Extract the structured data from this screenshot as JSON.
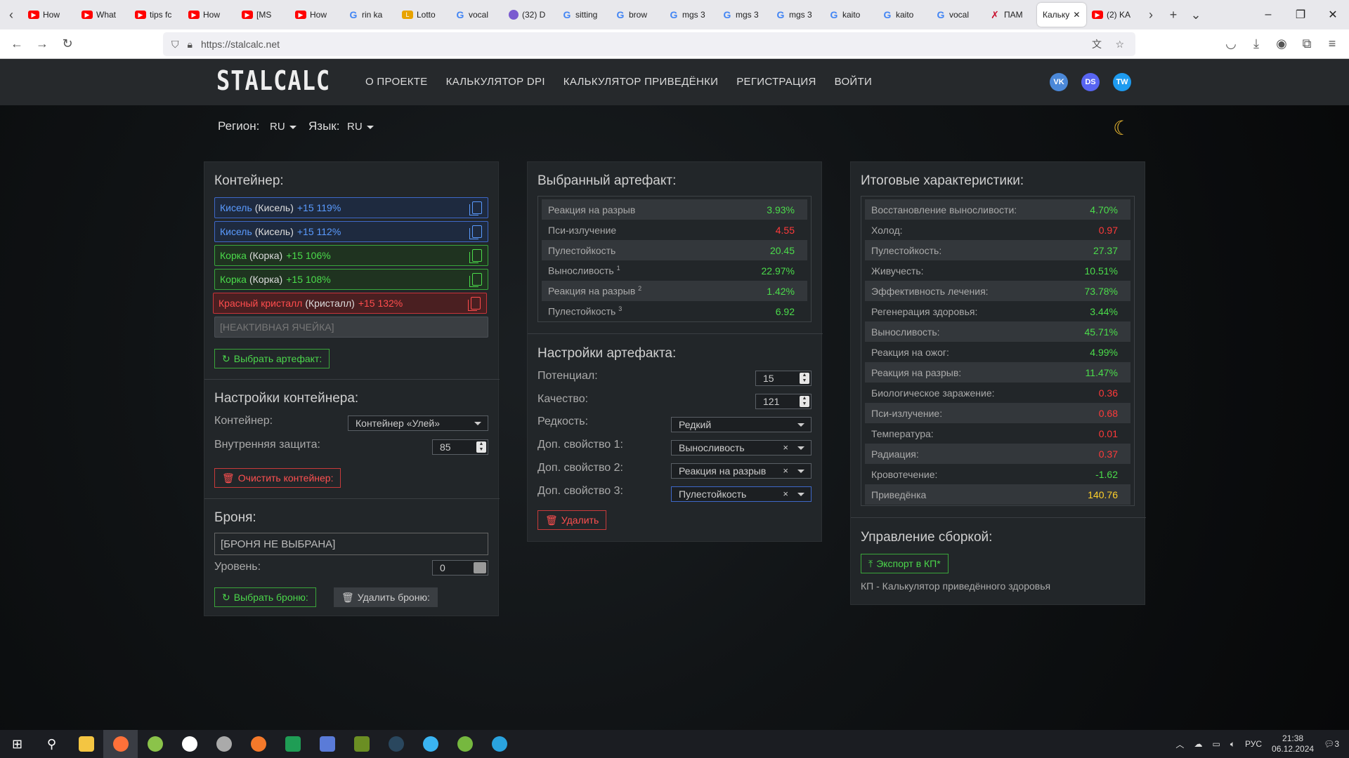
{
  "browser": {
    "tabs": [
      {
        "label": "How",
        "icon": "youtube-icon"
      },
      {
        "label": "What",
        "icon": "youtube-icon"
      },
      {
        "label": "tips fc",
        "icon": "youtube-icon"
      },
      {
        "label": "How",
        "icon": "youtube-icon"
      },
      {
        "label": "[MS",
        "icon": "youtube-icon"
      },
      {
        "label": "How",
        "icon": "youtube-icon"
      },
      {
        "label": "rin ka",
        "icon": "google-icon"
      },
      {
        "label": "Lotto",
        "icon": "lotto-icon"
      },
      {
        "label": "vocal",
        "icon": "google-icon"
      },
      {
        "label": "(32) D",
        "icon": "app-icon"
      },
      {
        "label": "sitting",
        "icon": "google-icon"
      },
      {
        "label": "brow",
        "icon": "google-icon"
      },
      {
        "label": "mgs 3",
        "icon": "google-icon"
      },
      {
        "label": "mgs 3",
        "icon": "google-icon"
      },
      {
        "label": "mgs 3",
        "icon": "google-icon"
      },
      {
        "label": "kaito",
        "icon": "google-icon"
      },
      {
        "label": "kaito",
        "icon": "google-icon"
      },
      {
        "label": "vocal",
        "icon": "google-icon"
      },
      {
        "label": "ПАМ",
        "icon": "sword-icon"
      },
      {
        "label": "Кальку",
        "icon": "none",
        "active": true
      },
      {
        "label": "(2) KA",
        "icon": "youtube-icon"
      }
    ],
    "url": "https://stalcalc.net"
  },
  "site": {
    "logo": "STALCALC",
    "menu": [
      "О ПРОЕКТЕ",
      "КАЛЬКУЛЯТОР DPI",
      "КАЛЬКУЛЯТОР ПРИВЕДЁНКИ",
      "РЕГИСТРАЦИЯ",
      "ВОЙТИ"
    ],
    "social": {
      "vk": "VK",
      "discord": "DS",
      "twitter": "TW"
    },
    "region_label": "Регион:",
    "region_value": "RU",
    "lang_label": "Язык:",
    "lang_value": "RU"
  },
  "container": {
    "title": "Контейнер:",
    "slots": [
      {
        "name": "Кисель",
        "sub": "(Кисель)",
        "val": "+15 119%"
      },
      {
        "name": "Кисель",
        "sub": "(Кисель)",
        "val": "+15 112%"
      },
      {
        "name": "Корка",
        "sub": "(Корка)",
        "val": "+15 106%"
      },
      {
        "name": "Корка",
        "sub": "(Корка)",
        "val": "+15 108%"
      },
      {
        "name": "Красный кристалл",
        "sub": "(Кристалл)",
        "val": "+15 132%"
      }
    ],
    "inactive_slot": "[НЕАКТИВНАЯ ЯЧЕЙКА]",
    "select_artifact_btn": "Выбрать артефакт:",
    "settings_title": "Настройки контейнера:",
    "container_label": "Контейнер:",
    "container_value": "Контейнер «Улей»",
    "inner_protection_label": "Внутренняя защита:",
    "inner_protection_value": "85",
    "clear_btn": "Очистить контейнер:",
    "armor_title": "Броня:",
    "armor_value": "[БРОНЯ НЕ ВЫБРАНА]",
    "level_label": "Уровень:",
    "level_value": "0",
    "select_armor_btn": "Выбрать броню:",
    "delete_armor_btn": "Удалить броню:"
  },
  "artifact": {
    "title": "Выбранный артефакт:",
    "stats": [
      {
        "name": "Реакция на разрыв",
        "sup": "",
        "val": "3.93%",
        "color": "green"
      },
      {
        "name": "Пси-излучение",
        "sup": "",
        "val": "4.55",
        "color": "red"
      },
      {
        "name": "Пулестойкость",
        "sup": "",
        "val": "20.45",
        "color": "green"
      },
      {
        "name": "Выносливость",
        "sup": "1",
        "val": "22.97%",
        "color": "green"
      },
      {
        "name": "Реакция на разрыв",
        "sup": "2",
        "val": "1.42%",
        "color": "green"
      },
      {
        "name": "Пулестойкость",
        "sup": "3",
        "val": "6.92",
        "color": "green"
      }
    ],
    "settings_title": "Настройки артефакта:",
    "potential_label": "Потенциал:",
    "potential_value": "15",
    "quality_label": "Качество:",
    "quality_value": "121",
    "rarity_label": "Редкость:",
    "rarity_value": "Редкий",
    "extra1_label": "Доп. свойство 1:",
    "extra1_value": "Выносливость",
    "extra2_label": "Доп. свойство 2:",
    "extra2_value": "Реакция на разрыв",
    "extra3_label": "Доп. свойство 3:",
    "extra3_value": "Пулестойкость",
    "clear_x": "×",
    "delete_btn": "Удалить"
  },
  "totals": {
    "title": "Итоговые характеристики:",
    "stats": [
      {
        "name": "Восстановление выносливости:",
        "val": "4.70%",
        "color": "green"
      },
      {
        "name": "Холод:",
        "val": "0.97",
        "color": "red"
      },
      {
        "name": "Пулестойкость:",
        "val": "27.37",
        "color": "green"
      },
      {
        "name": "Живучесть:",
        "val": "10.51%",
        "color": "green"
      },
      {
        "name": "Эффективность лечения:",
        "val": "73.78%",
        "color": "green"
      },
      {
        "name": "Регенерация здоровья:",
        "val": "3.44%",
        "color": "green"
      },
      {
        "name": "Выносливость:",
        "val": "45.71%",
        "color": "green"
      },
      {
        "name": "Реакция на ожог:",
        "val": "4.99%",
        "color": "green"
      },
      {
        "name": "Реакция на разрыв:",
        "val": "11.47%",
        "color": "green"
      },
      {
        "name": "Биологическое заражение:",
        "val": "0.36",
        "color": "red"
      },
      {
        "name": "Пси-излучение:",
        "val": "0.68",
        "color": "red"
      },
      {
        "name": "Температура:",
        "val": "0.01",
        "color": "red"
      },
      {
        "name": "Радиация:",
        "val": "0.37",
        "color": "red"
      },
      {
        "name": "Кровотечение:",
        "val": "-1.62",
        "color": "green"
      },
      {
        "name": "Приведёнка",
        "val": "140.76",
        "color": "yellow"
      }
    ],
    "build_title": "Управление сборкой:",
    "export_btn": "Экспорт в КП*",
    "footnote": "КП - Калькулятор приведённого здоровья"
  },
  "taskbar": {
    "lang": "РУС",
    "time": "21:38",
    "date": "06.12.2024",
    "notif": "3"
  }
}
